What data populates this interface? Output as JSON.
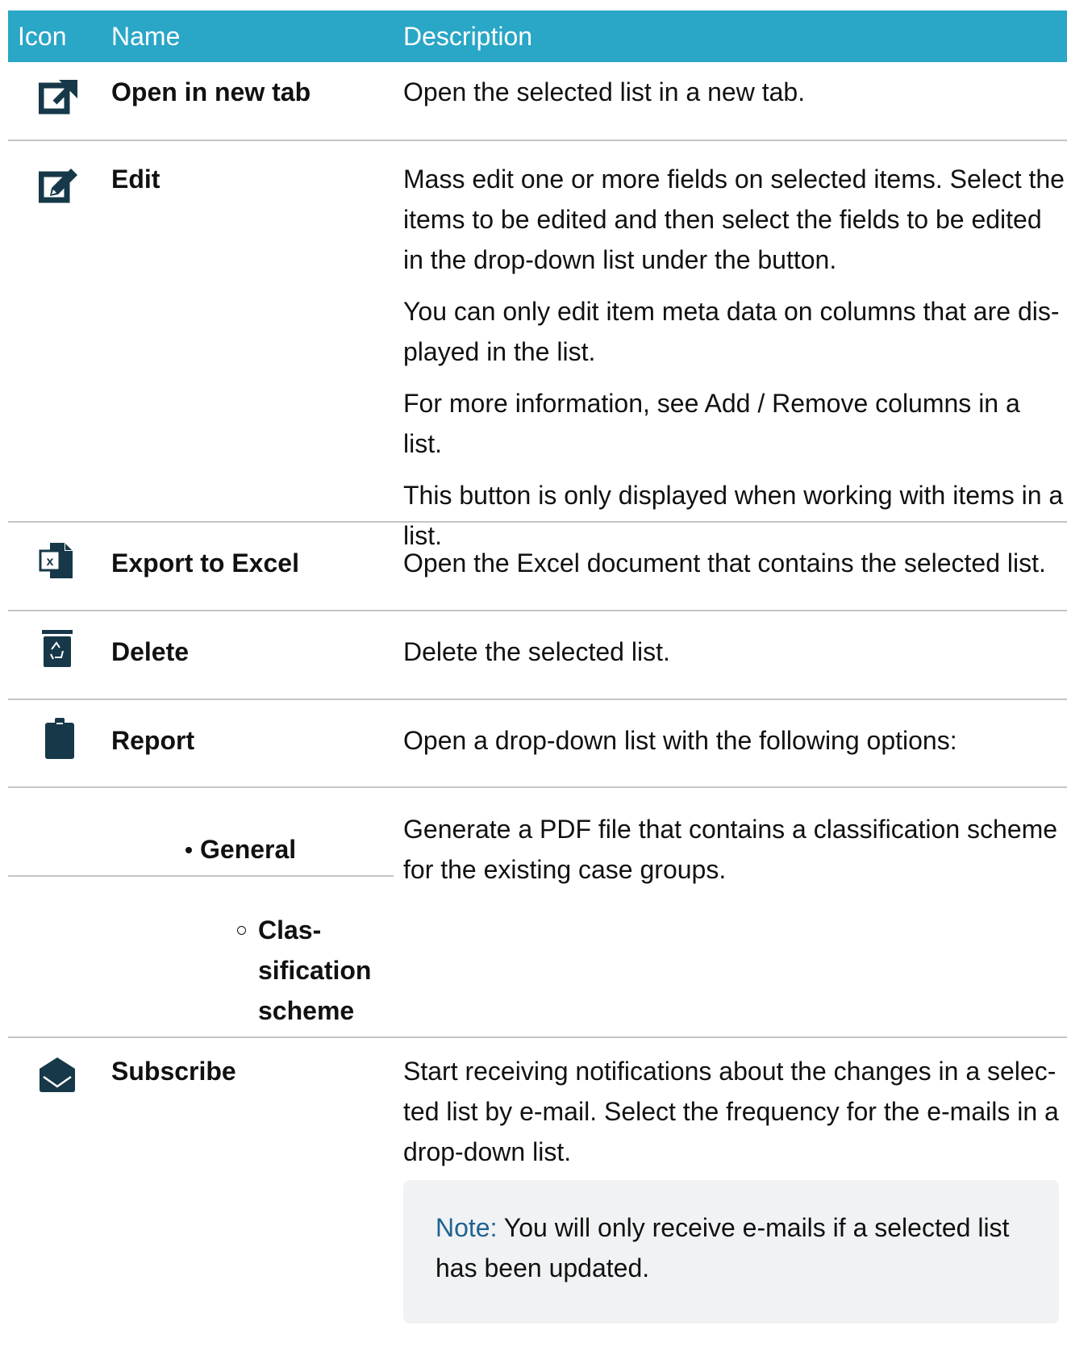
{
  "headers": {
    "icon": "Icon",
    "name": "Name",
    "description": "Description"
  },
  "rows": [
    {
      "icon": "open-in-new-tab-icon",
      "name": "Open in new tab",
      "desc": [
        "Open the selected list in a new tab."
      ]
    },
    {
      "icon": "edit-icon",
      "name": "Edit",
      "desc": [
        "Mass edit one or more fields on selected items. Select the items to be edited and then select the fields to be edited in the drop-down list under the button.",
        "You can only edit item meta data on columns that are dis- played in the list.",
        "For more information, see Add / Remove columns in a list.",
        "This button is only displayed when working with items in a list."
      ]
    },
    {
      "icon": "excel-icon",
      "name": "Export to Excel",
      "desc": [
        "Open the Excel document that contains the selected list."
      ]
    },
    {
      "icon": "trash-icon",
      "name": "Delete",
      "desc": [
        "Delete the selected list."
      ]
    },
    {
      "icon": "clipboard-icon",
      "name": "Report",
      "desc": [
        "Open a drop-down list with the following options:"
      ]
    },
    {
      "bullet": "General",
      "sub_bullet": [
        "Clas-",
        "sification",
        "scheme"
      ],
      "desc": [
        "Generate a PDF file that contains a classification scheme for the existing case groups."
      ]
    },
    {
      "icon": "envelope-icon",
      "name": "Subscribe",
      "desc": [
        "Start receiving notifications about the changes in a selec- ted list by e-mail. Select the frequency for the e-mails in a drop-down list."
      ]
    }
  ],
  "note": {
    "label": "Note:",
    "text": "You will only receive e-mails if a selected list has been updated."
  },
  "colors": {
    "header": "#2aa6c7",
    "icon": "#163848",
    "note_label": "#1f6390",
    "note_bg": "#f1f2f4",
    "divider": "#c4c4c4"
  }
}
